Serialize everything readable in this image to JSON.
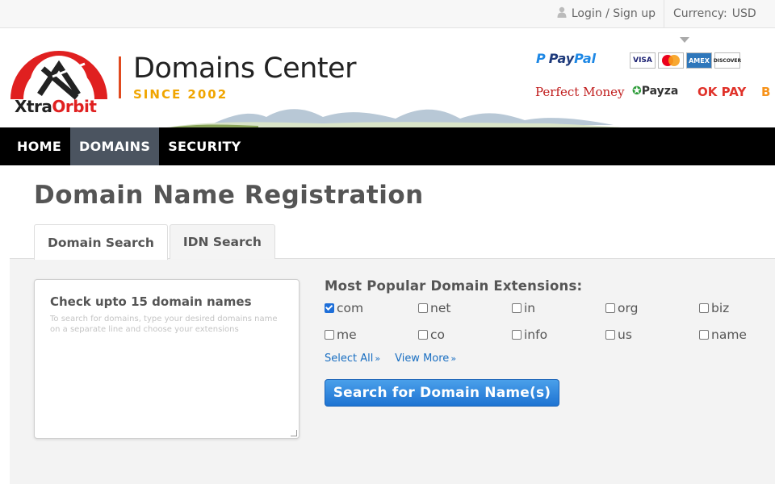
{
  "topbar": {
    "login_label": "Login / Sign up",
    "currency_label": "Currency:",
    "currency_value": "USD",
    "user_icon": "user-icon"
  },
  "header": {
    "logo_word_a": "Xtra",
    "logo_word_b": "Orbit",
    "brand_title": "Domains Center",
    "brand_since": "SINCE 2002",
    "payments": {
      "paypal_a": "Pay",
      "paypal_b": "Pal",
      "visa": "VISA",
      "amex": "AMEX",
      "discover": "DISCOVER",
      "perfect_money": "Perfect Money",
      "payza": "Payza",
      "okpay": "OK PAY",
      "bitcoin": "B"
    }
  },
  "nav": {
    "items": [
      {
        "label": "HOME"
      },
      {
        "label": "DOMAINS"
      },
      {
        "label": "SECURITY"
      }
    ]
  },
  "main": {
    "title": "Domain Name Registration",
    "tabs": [
      {
        "label": "Domain Search"
      },
      {
        "label": "IDN Search"
      }
    ],
    "textarea": {
      "title": "Check upto 15 domain names",
      "hint": "To search for domains, type your desired domains name on a separate line and choose your extensions"
    },
    "extensions_title": "Most Popular Domain Extensions:",
    "extensions": [
      {
        "label": "com",
        "checked": true
      },
      {
        "label": "net",
        "checked": false
      },
      {
        "label": "in",
        "checked": false
      },
      {
        "label": "org",
        "checked": false
      },
      {
        "label": "biz",
        "checked": false
      },
      {
        "label": "me",
        "checked": false
      },
      {
        "label": "co",
        "checked": false
      },
      {
        "label": "info",
        "checked": false
      },
      {
        "label": "us",
        "checked": false
      },
      {
        "label": "name",
        "checked": false
      }
    ],
    "select_all": "Select All",
    "view_more": "View More",
    "link_arrow": "»",
    "search_button": "Search for Domain Name(s)"
  },
  "colors": {
    "nav_bg": "#000000",
    "nav_active": "#4b5460",
    "button": "#1e73d2",
    "brand_accent": "#e04a1f"
  }
}
